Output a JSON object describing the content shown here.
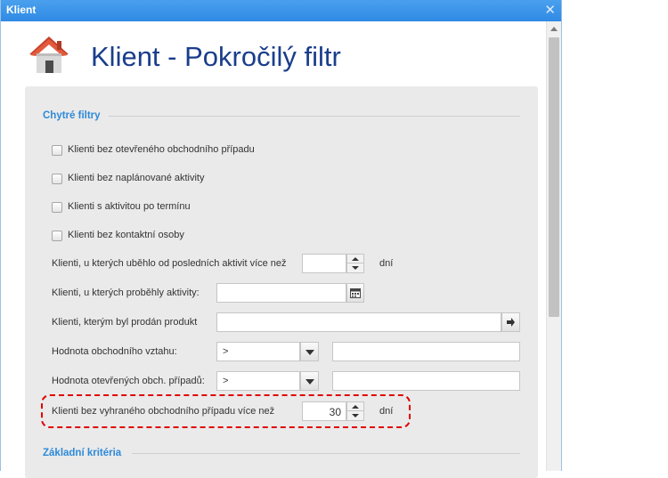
{
  "window": {
    "title": "Klient",
    "close_glyph": "✕"
  },
  "page": {
    "title": "Klient - Pokročilý filtr"
  },
  "sections": {
    "smart": {
      "title": "Chytré filtry"
    },
    "basic": {
      "title": "Základní kritéria"
    }
  },
  "checkboxes": [
    {
      "label": "Klienti bez otevřeného obchodního případu",
      "checked": false
    },
    {
      "label": "Klienti bez naplánované aktivity",
      "checked": false
    },
    {
      "label": "Klienti s aktivitou po termínu",
      "checked": false
    },
    {
      "label": "Klienti bez kontaktní osoby",
      "checked": false
    }
  ],
  "fields": {
    "since_last_activity": {
      "label": "Klienti, u kterých uběhlo od posledních aktivit více než",
      "value": "",
      "unit": "dní"
    },
    "activities_date": {
      "label": "Klienti, u kterých proběhly aktivity:",
      "value": ""
    },
    "sold_product": {
      "label": "Klienti, kterým byl prodán produkt",
      "value": ""
    },
    "relationship_value": {
      "label": "Hodnota obchodního vztahu:",
      "operator": ">",
      "value": ""
    },
    "open_cases_value": {
      "label": "Hodnota otevřených obch. případů:",
      "operator": ">",
      "value": ""
    },
    "no_won_case": {
      "label": "Klienti bez vyhraného obchodního případu více než",
      "value": "30",
      "unit": "dní"
    }
  },
  "colors": {
    "accent": "#2e8ad8",
    "title": "#1a3e8c",
    "highlight": "#e00000",
    "titlebar": "#3a93e8"
  }
}
